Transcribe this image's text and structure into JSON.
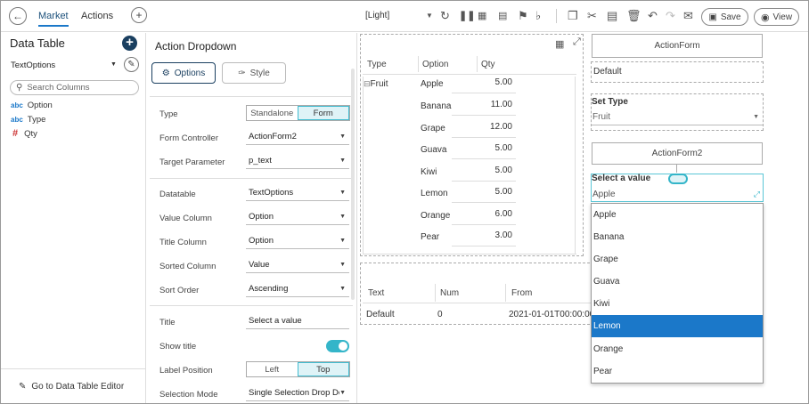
{
  "topbar": {
    "tabs": [
      "Market",
      "Actions"
    ],
    "theme": "[Light]",
    "save_label": "Save",
    "view_label": "View"
  },
  "left_panel": {
    "title": "Data Table",
    "datatable": "TextOptions",
    "search_placeholder": "Search Columns",
    "columns": [
      {
        "type": "abc",
        "name": "Option"
      },
      {
        "type": "abc",
        "name": "Type"
      },
      {
        "type": "#",
        "name": "Qty"
      }
    ],
    "footer_link": "Go to Data Table Editor"
  },
  "action_panel": {
    "title": "Action Dropdown",
    "tab_options": "Options",
    "tab_style": "Style",
    "type_label": "Type",
    "type_options": [
      "Standalone",
      "Form"
    ],
    "type_selected": "Form",
    "form_controller_label": "Form Controller",
    "form_controller": "ActionForm2",
    "target_parameter_label": "Target Parameter",
    "target_parameter": "p_text",
    "datatable_label": "Datatable",
    "datatable": "TextOptions",
    "value_column_label": "Value Column",
    "value_column": "Option",
    "title_column_label": "Title Column",
    "title_column": "Option",
    "sorted_column_label": "Sorted Column",
    "sorted_column": "Value",
    "sort_order_label": "Sort Order",
    "sort_order": "Ascending",
    "title_label": "Title",
    "title_value": "Select a value",
    "show_title_label": "Show title",
    "show_title": true,
    "label_position_label": "Label Position",
    "label_position_options": [
      "Left",
      "Top"
    ],
    "label_position_selected": "Top",
    "selection_mode_label": "Selection Mode",
    "selection_mode": "Single Selection Drop Do"
  },
  "table1": {
    "headers": [
      "Type",
      "Option",
      "Qty"
    ],
    "group": "Fruit",
    "rows": [
      {
        "option": "Apple",
        "qty": "5.00"
      },
      {
        "option": "Banana",
        "qty": "11.00"
      },
      {
        "option": "Grape",
        "qty": "12.00"
      },
      {
        "option": "Guava",
        "qty": "5.00"
      },
      {
        "option": "Kiwi",
        "qty": "5.00"
      },
      {
        "option": "Lemon",
        "qty": "5.00"
      },
      {
        "option": "Orange",
        "qty": "6.00"
      },
      {
        "option": "Pear",
        "qty": "3.00"
      }
    ]
  },
  "table2": {
    "headers": [
      "Text",
      "Num",
      "From"
    ],
    "row": [
      "Default",
      "0",
      "2021-01-01T00:00:00"
    ]
  },
  "forms": {
    "action_form": "ActionForm",
    "default_text": "Default",
    "set_type_label": "Set Type",
    "set_type_value": "Fruit",
    "action_form2": "ActionForm2",
    "select_label": "Select a value",
    "select_value": "Apple",
    "dropdown_items": [
      "Apple",
      "Banana",
      "Grape",
      "Guava",
      "Kiwi",
      "Lemon",
      "Orange",
      "Pear"
    ],
    "dropdown_selected": "Lemon"
  },
  "colors": {
    "accent": "#1b78c9",
    "toggle": "#34b5c9",
    "addbtn": "#1a3f60"
  }
}
